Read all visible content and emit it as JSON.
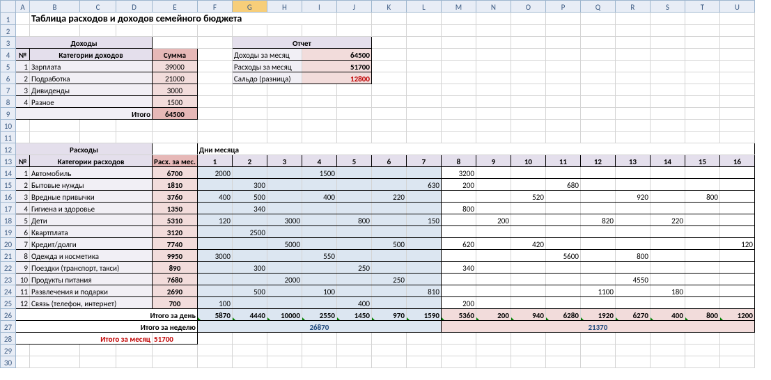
{
  "cols": [
    "",
    "A",
    "B",
    "C",
    "D",
    "E",
    "F",
    "G",
    "H",
    "I",
    "J",
    "K",
    "L",
    "M",
    "N",
    "O",
    "P",
    "Q",
    "R",
    "S",
    "T",
    "U"
  ],
  "selCol": "G",
  "title": "Таблица расходов и доходов семейного бюджета",
  "income": {
    "header": "Доходы",
    "numH": "№",
    "catH": "Категории доходов",
    "sumH": "Сумма",
    "rows": [
      {
        "n": "1",
        "name": "Зарплата",
        "sum": "39000"
      },
      {
        "n": "2",
        "name": "Подработка",
        "sum": "21000"
      },
      {
        "n": "3",
        "name": "Дивиденды",
        "sum": "3000"
      },
      {
        "n": "4",
        "name": "Разное",
        "sum": "1500"
      }
    ],
    "totalLbl": "Итого",
    "total": "64500"
  },
  "report": {
    "header": "Отчет",
    "r1": {
      "l": "Доходы за месяц",
      "v": "64500"
    },
    "r2": {
      "l": "Расходы за месяц",
      "v": "51700"
    },
    "r3": {
      "l": "Сальдо (разница)",
      "v": "12800"
    }
  },
  "exp": {
    "header": "Расходы",
    "daysHeader": "Дни месяца",
    "numH": "№",
    "catH": "Категории расходов",
    "monH": "Расх. за мес.",
    "days": [
      "1",
      "2",
      "3",
      "4",
      "5",
      "6",
      "7",
      "8",
      "9",
      "10",
      "11",
      "12",
      "13",
      "14",
      "15",
      "16"
    ],
    "rows": [
      {
        "n": "1",
        "name": "Автомобиль",
        "m": "6700",
        "d": [
          "2000",
          "",
          "",
          "1500",
          "",
          "",
          "",
          "3200",
          "",
          "",
          "",
          "",
          "",
          "",
          "",
          ""
        ]
      },
      {
        "n": "2",
        "name": "Бытовые нужды",
        "m": "1810",
        "d": [
          "",
          "300",
          "",
          "",
          "",
          "",
          "630",
          "200",
          "",
          "",
          "680",
          "",
          "",
          "",
          "",
          ""
        ]
      },
      {
        "n": "3",
        "name": "Вредные привычки",
        "m": "3760",
        "d": [
          "400",
          "500",
          "",
          "400",
          "",
          "220",
          "",
          "",
          "",
          "520",
          "",
          "",
          "920",
          "",
          "800",
          ""
        ]
      },
      {
        "n": "4",
        "name": "Гигиена и здоровье",
        "m": "1350",
        "d": [
          "",
          "340",
          "",
          "",
          "",
          "",
          "",
          "800",
          "",
          "",
          "",
          "",
          "",
          "",
          "",
          ""
        ]
      },
      {
        "n": "5",
        "name": "Дети",
        "m": "5310",
        "d": [
          "120",
          "",
          "3000",
          "",
          "800",
          "",
          "150",
          "",
          "200",
          "",
          "",
          "820",
          "",
          "220",
          "",
          ""
        ]
      },
      {
        "n": "6",
        "name": "Квартплата",
        "m": "3120",
        "d": [
          "",
          "2500",
          "",
          "",
          "",
          "",
          "",
          "",
          "",
          "",
          "",
          "",
          "",
          "",
          "",
          ""
        ]
      },
      {
        "n": "7",
        "name": "Кредит/долги",
        "m": "7740",
        "d": [
          "",
          "",
          "5000",
          "",
          "",
          "500",
          "",
          "620",
          "",
          "420",
          "",
          "",
          "",
          "",
          "",
          "120"
        ]
      },
      {
        "n": "8",
        "name": "Одежда и косметика",
        "m": "9950",
        "d": [
          "3000",
          "",
          "",
          "550",
          "",
          "",
          "",
          "",
          "",
          "",
          "5600",
          "",
          "800",
          "",
          "",
          ""
        ]
      },
      {
        "n": "9",
        "name": "Поездки (транспорт, такси)",
        "m": "890",
        "d": [
          "",
          "300",
          "",
          "",
          "250",
          "",
          "",
          "340",
          "",
          "",
          "",
          "",
          "",
          "",
          "",
          ""
        ]
      },
      {
        "n": "10",
        "name": "Продукты питания",
        "m": "7680",
        "d": [
          "",
          "",
          "2000",
          "",
          "",
          "250",
          "",
          "",
          "",
          "",
          "",
          "",
          "4550",
          "",
          "",
          ""
        ]
      },
      {
        "n": "11",
        "name": "Развлечения и подарки",
        "m": "2690",
        "d": [
          "",
          "500",
          "",
          "100",
          "",
          "",
          "810",
          "",
          "",
          "",
          "",
          "1100",
          "",
          "180",
          "",
          ""
        ]
      },
      {
        "n": "12",
        "name": "Связь (телефон, интернет)",
        "m": "700",
        "d": [
          "100",
          "",
          "",
          "",
          "400",
          "",
          "",
          "200",
          "",
          "",
          "",
          "",
          "",
          "",
          "",
          ""
        ]
      }
    ],
    "dayTotalLbl": "Итого за день",
    "dayTotals": [
      "5870",
      "4440",
      "10000",
      "2550",
      "1450",
      "970",
      "1590",
      "5360",
      "200",
      "940",
      "6280",
      "1920",
      "6270",
      "400",
      "800",
      "1200"
    ],
    "weekTotalLbl": "Итого за неделю",
    "weekTotals": [
      "26870",
      "21370"
    ],
    "monthTotalLbl": "Итого за месяц",
    "monthTotal": "51700"
  }
}
